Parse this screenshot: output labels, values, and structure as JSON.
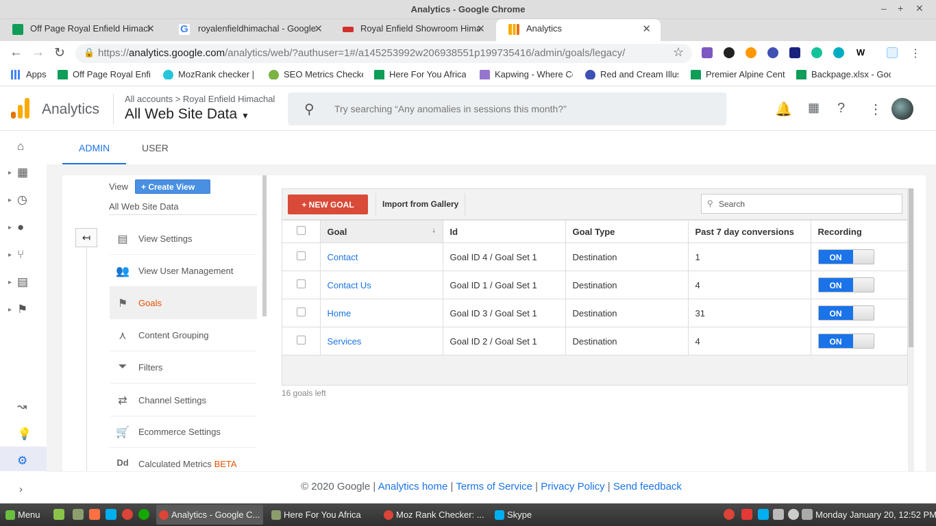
{
  "window": {
    "title": "Analytics - Google Chrome"
  },
  "tabs": [
    {
      "label": "Off Page Royal Enfield Himachal",
      "icon": "sheets-icon",
      "color": "#0f9d58"
    },
    {
      "label": "royalenfieldhimachal - Google Search",
      "icon": "google-icon",
      "color": "#4285f4"
    },
    {
      "label": "Royal Enfield Showroom Himachal",
      "icon": "re-icon",
      "color": "#d32f2f"
    },
    {
      "label": "Analytics",
      "icon": "analytics-icon",
      "color": "#f9ab00"
    }
  ],
  "toolbar": {
    "url_domain": "analytics.google.com",
    "url_path": "/analytics/web/?authuser=1#/a145253992w206938551p199735416/admin/goals/legacy/",
    "url_scheme": "https://"
  },
  "bookmarks": [
    {
      "label": "Apps"
    },
    {
      "label": "Off Page Royal Enfie"
    },
    {
      "label": "MozRank checker |"
    },
    {
      "label": "SEO Metrics Checke"
    },
    {
      "label": "Here For You Africa"
    },
    {
      "label": "Kapwing - Where Co"
    },
    {
      "label": "Red and Cream Illus"
    },
    {
      "label": "Premier Alpine Cent"
    },
    {
      "label": "Backpage.xlsx - Goo"
    }
  ],
  "header": {
    "app_name": "Analytics",
    "accounts_crumb": "All accounts",
    "account_name": "Royal Enfield Himachal",
    "property_view": "All Web Site Data",
    "search_placeholder": "Try searching “Any anomalies in sessions this month?”"
  },
  "admin_tabs": {
    "admin": "ADMIN",
    "user": "USER"
  },
  "view_col": {
    "view_label": "View",
    "create_view": "+ Create View",
    "view_name": "All Web Site Data",
    "menu": [
      {
        "label": "View Settings",
        "icon": "document-icon"
      },
      {
        "label": "View User Management",
        "icon": "users-icon"
      },
      {
        "label": "Goals",
        "icon": "flag-icon"
      },
      {
        "label": "Content Grouping",
        "icon": "content-grouping-icon"
      },
      {
        "label": "Filters",
        "icon": "filter-icon"
      },
      {
        "label": "Channel Settings",
        "icon": "channel-icon"
      },
      {
        "label": "Ecommerce Settings",
        "icon": "cart-icon"
      },
      {
        "label": "Calculated Metrics",
        "icon": "dd-icon",
        "badge": "BETA"
      }
    ]
  },
  "goals": {
    "new_goal": "+ NEW GOAL",
    "import": "Import from Gallery",
    "search_placeholder": "Search",
    "columns": [
      "Goal",
      "Id",
      "Goal Type",
      "Past 7 day conversions",
      "Recording"
    ],
    "rows": [
      {
        "goal": "Contact",
        "id": "Goal ID 4 / Goal Set 1",
        "type": "Destination",
        "conversions": "1",
        "recording": "ON"
      },
      {
        "goal": "Contact Us",
        "id": "Goal ID 1 / Goal Set 1",
        "type": "Destination",
        "conversions": "4",
        "recording": "ON"
      },
      {
        "goal": "Home",
        "id": "Goal ID 3 / Goal Set 1",
        "type": "Destination",
        "conversions": "31",
        "recording": "ON"
      },
      {
        "goal": "Services",
        "id": "Goal ID 2 / Goal Set 1",
        "type": "Destination",
        "conversions": "4",
        "recording": "ON"
      }
    ],
    "remaining": "16 goals left"
  },
  "footer": {
    "copyright": "© 2020 Google |",
    "links": [
      "Analytics home",
      "Terms of Service",
      "Privacy Policy",
      "Send feedback"
    ]
  },
  "taskbar": {
    "menu": "Menu",
    "windows": [
      "Analytics - Google C...",
      "Here For You Africa",
      "Moz Rank Checker: ...",
      "Skype"
    ],
    "clock": "Monday January 20, 12:52 PM"
  },
  "colors": {
    "accent": "#1a73e8",
    "new_goal": "#d94a38",
    "selected_menu": "#e65100"
  }
}
